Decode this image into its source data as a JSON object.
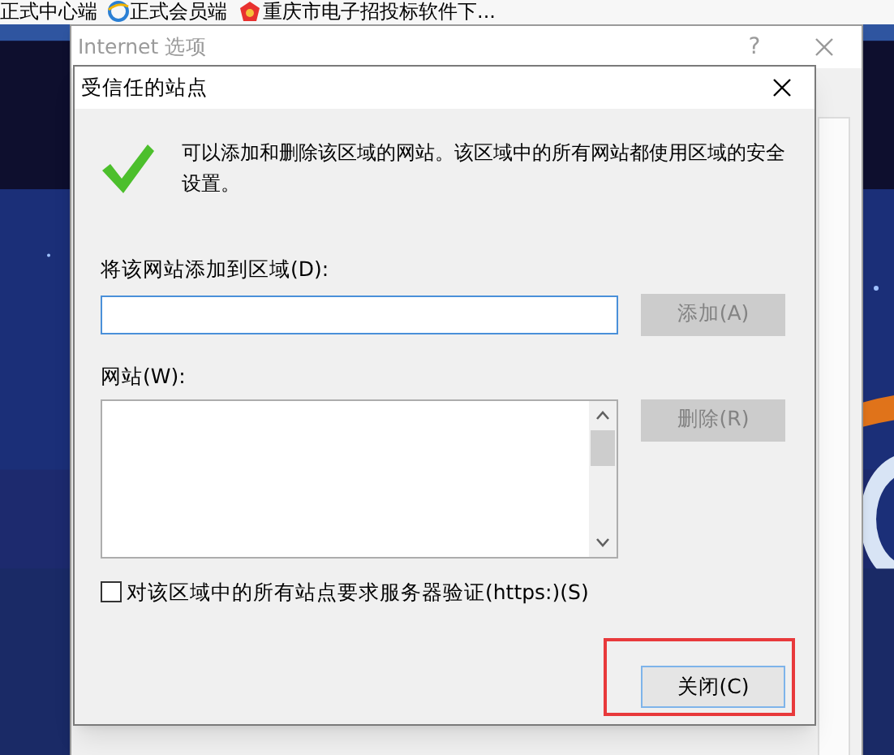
{
  "bookmarks_bar": {
    "items": [
      {
        "label": "正式中心端",
        "kind": "plain"
      },
      {
        "label": "正式会员端",
        "kind": "ie"
      },
      {
        "label": "重庆市电子招投标软件下...",
        "kind": "red"
      }
    ]
  },
  "window": {
    "title": "Internet 选项",
    "help": "?"
  },
  "dialog": {
    "title": "受信任的站点",
    "description": "可以添加和删除该区域的网站。该区域中的所有网站都使用区域的安全设置。",
    "add_label": "将该网站添加到区域(D):",
    "add_button": {
      "label": "添加(A)",
      "disabled": true
    },
    "list_label": "网站(W):",
    "remove_button": {
      "label": "删除(R)",
      "disabled": true
    },
    "https_checkbox": {
      "label": "对该区域中的所有站点要求服务器验证(https:)(S)",
      "checked": false
    },
    "close_button": {
      "label": "关闭(C)",
      "highlighted": true
    }
  }
}
